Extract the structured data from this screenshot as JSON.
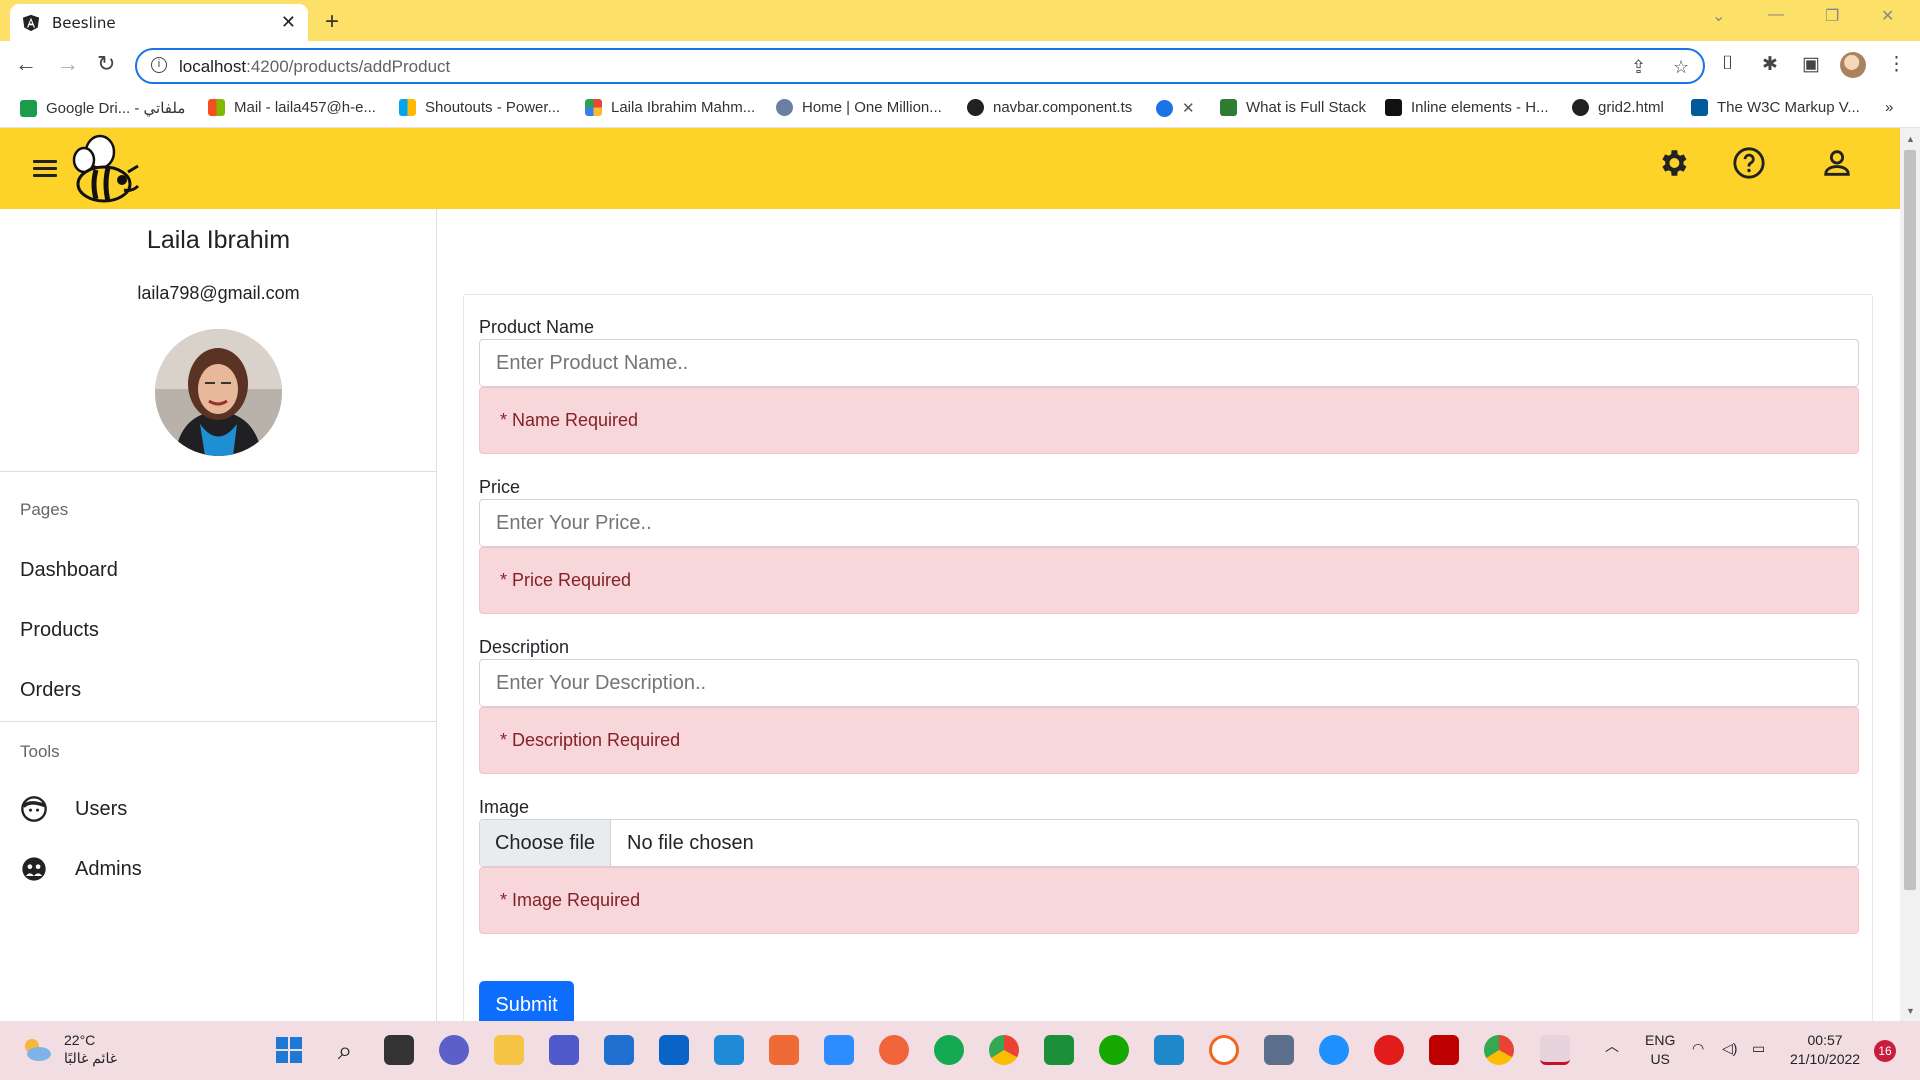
{
  "browser": {
    "tab_title": "Beesline",
    "url_host": "localhost",
    "url_path": ":4200/products/addProduct",
    "bookmarks": [
      {
        "label": "Google Dri... - ملفاتي",
        "color": "#1a9c4a"
      },
      {
        "label": "Mail - laila457@h-e...",
        "color": "#f25022"
      },
      {
        "label": "Shoutouts - Power...",
        "color": "#f25022"
      },
      {
        "label": "Laila Ibrahim Mahm...",
        "color": "#e8453c"
      },
      {
        "label": "Home | One Million...",
        "color": "#6b7fa3"
      },
      {
        "label": "navbar.component.ts",
        "color": "#222222"
      },
      {
        "label": "",
        "color": "#1a73e8"
      },
      {
        "label": "What is Full Stack",
        "color": "#2e7d32"
      },
      {
        "label": "Inline elements - H...",
        "color": "#111111"
      },
      {
        "label": "grid2.html",
        "color": "#222222"
      },
      {
        "label": "The W3C Markup V...",
        "color": "#005a9c"
      }
    ]
  },
  "app": {
    "user": {
      "name": "Laila Ibrahim",
      "email": "laila798@gmail.com"
    },
    "sidebar": {
      "pages_label": "Pages",
      "pages": [
        "Dashboard",
        "Products",
        "Orders"
      ],
      "tools_label": "Tools",
      "tools": [
        {
          "label": "Users",
          "icon": "user-face-icon"
        },
        {
          "label": "Admins",
          "icon": "admins-icon"
        }
      ]
    },
    "header": {
      "icons": [
        "menu-icon",
        "settings-icon",
        "help-icon",
        "account-icon"
      ]
    },
    "form": {
      "name": {
        "label": "Product Name",
        "placeholder": "Enter Product Name..",
        "error": "* Name Required"
      },
      "price": {
        "label": "Price",
        "placeholder": "Enter Your Price..",
        "error": "* Price Required"
      },
      "description": {
        "label": "Description",
        "placeholder": "Enter Your Description..",
        "error": "* Description Required"
      },
      "image": {
        "label": "Image",
        "button": "Choose file",
        "status": "No file chosen",
        "error": "* Image Required"
      },
      "submit": "Submit"
    },
    "colors": {
      "header_bg": "#fdd329",
      "alert_bg": "#f8d7da",
      "alert_text": "#842029",
      "primary": "#0d6efd"
    }
  },
  "taskbar": {
    "weather_temp": "22°C",
    "weather_desc": "غائم غالبًا",
    "lang_top": "ENG",
    "lang_bottom": "US",
    "time": "00:57",
    "date": "21/10/2022",
    "notification_count": "16"
  }
}
